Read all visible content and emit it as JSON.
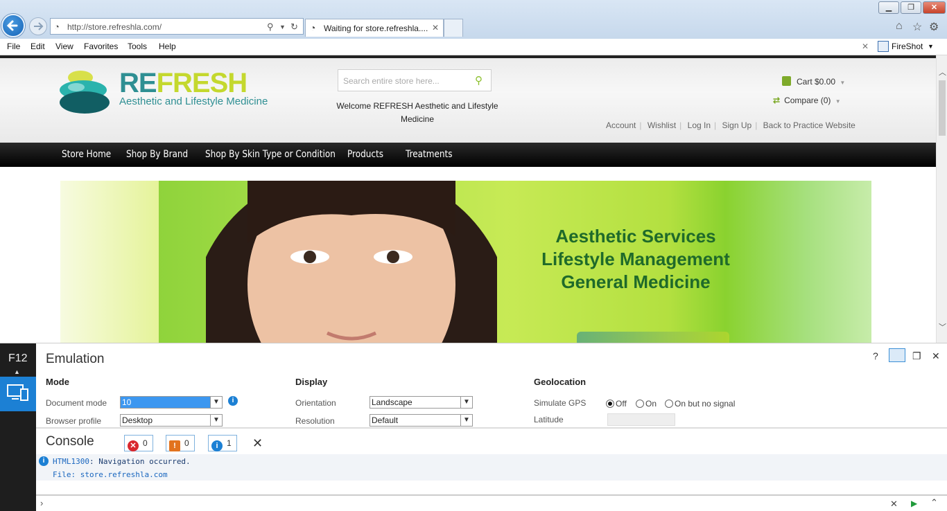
{
  "browser": {
    "address": "http://store.refreshla.com/",
    "tab_title": "Waiting for store.refreshla....",
    "window_buttons": {
      "minimize": "▁",
      "restore": "❐",
      "close": "✕"
    },
    "menu": [
      "File",
      "Edit",
      "View",
      "Favorites",
      "Tools",
      "Help"
    ],
    "fireshot": "FireShot"
  },
  "store": {
    "logo_re": "RE",
    "logo_fresh": "FRESH",
    "logo_sub": "Aesthetic and Lifestyle Medicine",
    "search_placeholder": "Search entire store here...",
    "welcome": "Welcome REFRESH Aesthetic and Lifestyle Medicine",
    "cart": "Cart $0.00",
    "compare": "Compare (0)",
    "links": [
      "Account",
      "Wishlist",
      "Log In",
      "Sign Up",
      "Back to Practice Website"
    ],
    "nav": [
      "Store Home",
      "Shop By Brand",
      "Shop By Skin Type or Condition",
      "Products",
      "Treatments"
    ],
    "banner_lines": [
      "Aesthetic Services",
      "Lifestyle Management",
      "General Medicine"
    ],
    "colors": {
      "teal": "#2f8f93",
      "lime": "#c4d82e",
      "nav_bg": "#000000",
      "devtools_accent": "#1c80d4"
    }
  },
  "devtools": {
    "f12": "F12",
    "title": "Emulation",
    "sections": {
      "mode": "Mode",
      "display": "Display",
      "geolocation": "Geolocation"
    },
    "document_mode_label": "Document mode",
    "document_mode_value": "10",
    "browser_profile_label": "Browser profile",
    "browser_profile_value": "Desktop",
    "orientation_label": "Orientation",
    "orientation_value": "Landscape",
    "resolution_label": "Resolution",
    "resolution_value": "Default",
    "simulate_gps_label": "Simulate GPS",
    "gps_options": [
      "Off",
      "On",
      "On but no signal"
    ],
    "gps_selected": "Off",
    "latitude_label": "Latitude",
    "console_title": "Console",
    "errors": "0",
    "warnings": "0",
    "infos": "1",
    "console_code": "HTML1300",
    "console_message": ": Navigation occurred.",
    "console_file": "File: store.refreshla.com"
  }
}
